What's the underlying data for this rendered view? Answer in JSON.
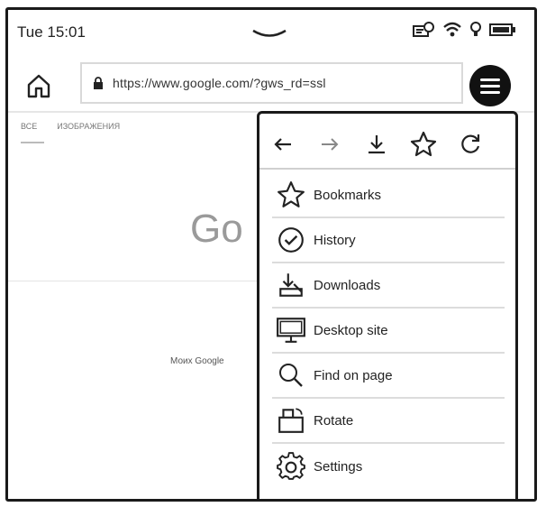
{
  "status_bar": {
    "time": "Tue 15:01",
    "icons": [
      "sync-icon",
      "wifi-icon",
      "frontlight-icon",
      "battery-icon"
    ]
  },
  "address_bar": {
    "url": "https://www.google.com/?gws_rd=ssl",
    "lock_icon": "lock-icon"
  },
  "page": {
    "tabs": [
      "ВСЕ",
      "ИЗОБРАЖЕНИЯ"
    ],
    "logo_text": "Go",
    "more_link": "Моих Google"
  },
  "menu": {
    "toolbar": [
      {
        "name": "back-icon"
      },
      {
        "name": "forward-icon"
      },
      {
        "name": "download-icon"
      },
      {
        "name": "bookmark-star-icon"
      },
      {
        "name": "reload-icon"
      }
    ],
    "items": [
      {
        "label": "Bookmarks",
        "icon": "star-icon"
      },
      {
        "label": "History",
        "icon": "clock-icon"
      },
      {
        "label": "Downloads",
        "icon": "downloads-icon"
      },
      {
        "label": "Desktop site",
        "icon": "monitor-icon"
      },
      {
        "label": "Find on page",
        "icon": "magnifier-icon"
      },
      {
        "label": "Rotate",
        "icon": "rotate-icon"
      },
      {
        "label": "Settings",
        "icon": "gear-icon"
      }
    ]
  },
  "colors": {
    "ink": "#1a1a1a",
    "divider": "#dcdcdc",
    "background": "#ffffff"
  }
}
